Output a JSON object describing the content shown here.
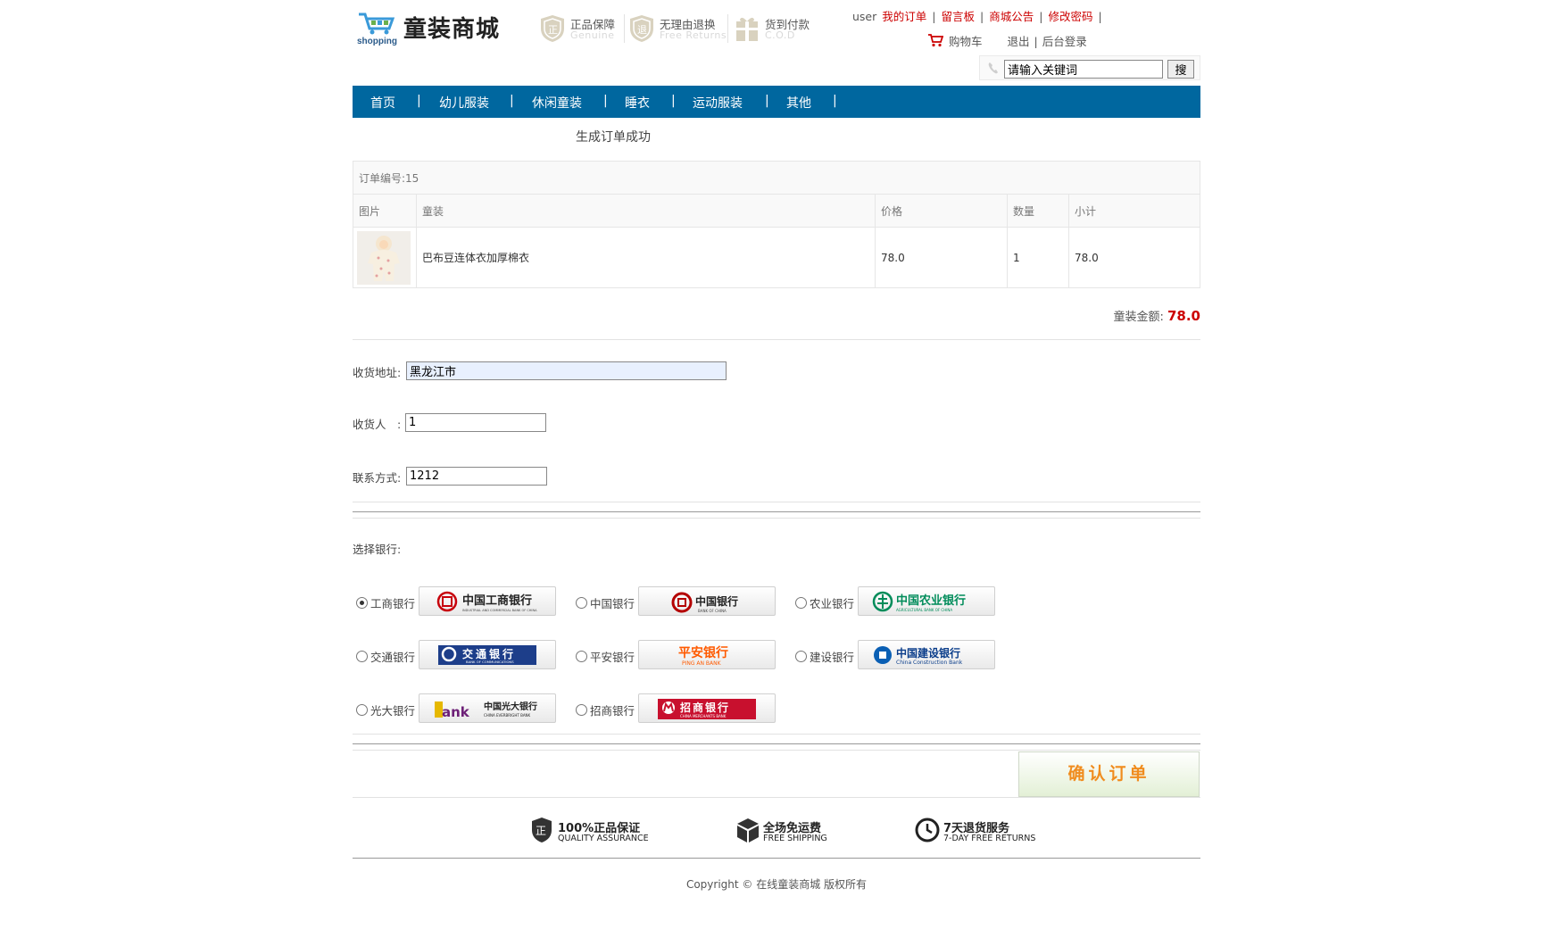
{
  "header": {
    "logo_small": "shopping",
    "logo_text": "童装商城",
    "promises": [
      {
        "title": "正品保障",
        "sub": "Genuine",
        "icon": "genuine-shield-icon"
      },
      {
        "title": "无理由退换",
        "sub": "Free Returns",
        "icon": "returns-shield-icon"
      },
      {
        "title": "货到付款",
        "sub": "C.O.D",
        "icon": "cod-gift-icon"
      }
    ],
    "user": "user",
    "links": [
      "我的订单",
      "留言板",
      "商城公告",
      "修改密码"
    ],
    "cart": "购物车",
    "logout": "退出",
    "admin": "后台登录",
    "search_value": "请输入关键词",
    "search_button": "搜"
  },
  "nav": [
    "首页",
    "幼儿服装",
    "休闲童装",
    "睡衣",
    "运动服装",
    "其他"
  ],
  "nav_separator": "|",
  "success_message": "生成订单成功",
  "order": {
    "number_label": "订单编号:15",
    "columns": [
      "图片",
      "童装",
      "价格",
      "数量",
      "小计"
    ],
    "rows": [
      {
        "name": "巴布豆连体衣加厚棉衣",
        "price": "78.0",
        "qty": "1",
        "subtotal": "78.0"
      }
    ],
    "total_label": "童装金额:",
    "total_value": "78.0"
  },
  "form": {
    "address_label": "收货地址:",
    "address_value": "黑龙江市",
    "receiver_label": "收货人　:",
    "receiver_value": "1",
    "contact_label": "联系方式:",
    "contact_value": "1212"
  },
  "bank_label": "选择银行:",
  "banks": [
    {
      "name": "工商银行",
      "logo_text": "中国工商银行",
      "sub": "INDUSTRIAL AND COMMERCIAL BANK OF CHINA",
      "selected": true
    },
    {
      "name": "中国银行",
      "logo_text": "中国银行",
      "sub": "BANK OF CHINA",
      "selected": false
    },
    {
      "name": "农业银行",
      "logo_text": "中国农业银行",
      "sub": "AGRICULTURAL BANK OF CHINA",
      "selected": false
    },
    {
      "name": "交通银行",
      "logo_text": "交通银行",
      "sub": "BANK OF COMMUNICATIONS",
      "selected": false
    },
    {
      "name": "平安银行",
      "logo_text": "平安银行",
      "sub": "PING AN BANK",
      "selected": false
    },
    {
      "name": "建设银行",
      "logo_text": "中国建设银行",
      "sub": "China Construction Bank",
      "selected": false
    },
    {
      "name": "光大银行",
      "logo_text": "中国光大银行",
      "sub": "CHINA EVERBRIGHT BANK",
      "selected": false
    },
    {
      "name": "招商银行",
      "logo_text": "招商银行",
      "sub": "CHINA MERCHANTS BANK",
      "selected": false
    }
  ],
  "confirm_button": "确认订单",
  "guarantees": [
    {
      "title": "100%正品保证",
      "sub": "QUALITY ASSURANCE",
      "icon": "quality-shield-icon"
    },
    {
      "title": "全场免运费",
      "sub": "FREE SHIPPING",
      "icon": "box-icon"
    },
    {
      "title": "7天退货服务",
      "sub": "7-DAY FREE RETURNS",
      "icon": "clock-icon"
    }
  ],
  "copyright": "Copyright © 在线童装商城 版权所有",
  "colors": {
    "nav_bg": "#00679f",
    "link_red": "#cc0000",
    "confirm_text": "#f08c1e"
  }
}
